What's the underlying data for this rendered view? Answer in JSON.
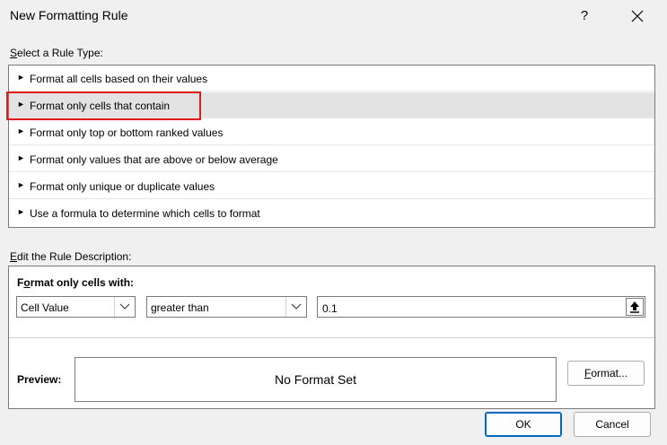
{
  "window": {
    "title": "New Formatting Rule",
    "help": "?"
  },
  "rule_type": {
    "label_u": "S",
    "label_rest": "elect a Rule Type:",
    "items": [
      {
        "label": "Format all cells based on their values"
      },
      {
        "label": "Format only cells that contain"
      },
      {
        "label": "Format only top or bottom ranked values"
      },
      {
        "label": "Format only values that are above or below average"
      },
      {
        "label": "Format only unique or duplicate values"
      },
      {
        "label": "Use a formula to determine which cells to format"
      }
    ],
    "selected_index": 1
  },
  "description": {
    "label_u": "E",
    "label_rest": "dit the Rule Description:",
    "format_label_pre": "F",
    "format_label_u": "o",
    "format_label_rest": "rmat only cells with:",
    "field1": "Cell Value",
    "operator": "greater than",
    "value": "0.1"
  },
  "preview": {
    "label": "Preview:",
    "text": "No Format Set",
    "format_btn_u": "F",
    "format_btn_rest": "ormat..."
  },
  "buttons": {
    "ok": "OK",
    "cancel": "Cancel"
  }
}
